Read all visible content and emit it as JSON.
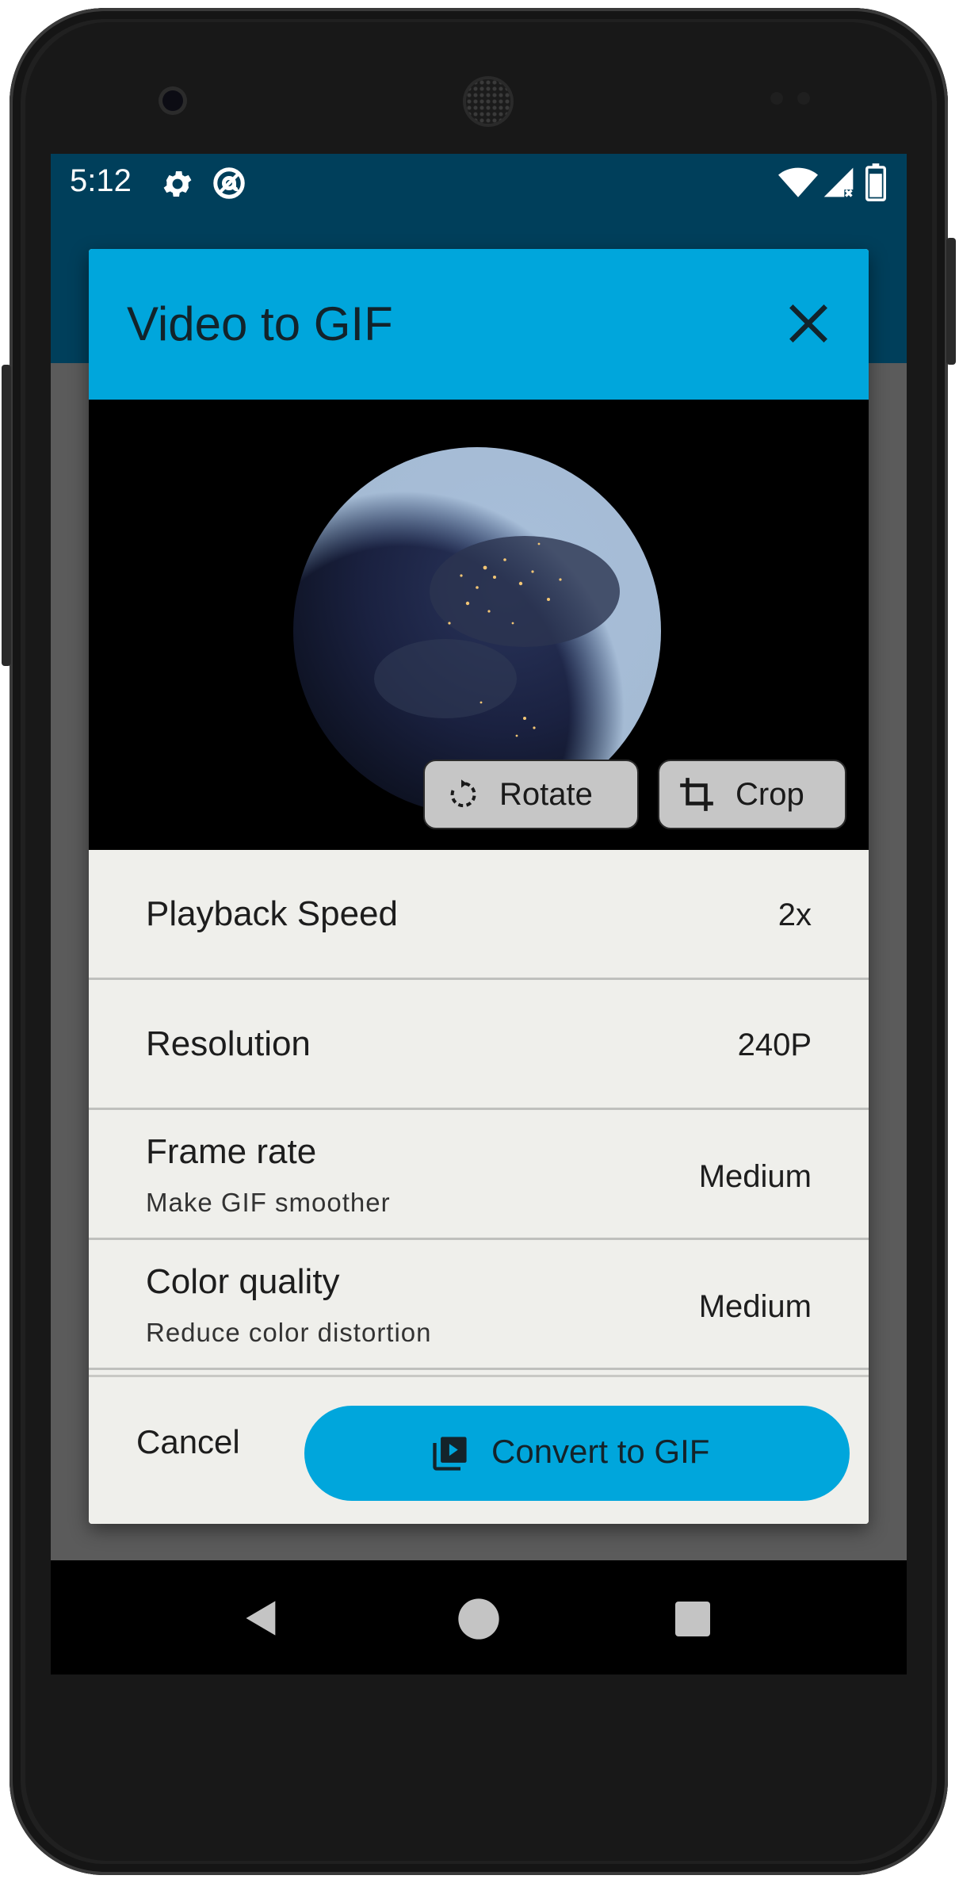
{
  "status_bar": {
    "time": "5:12",
    "icons": [
      "settings-icon",
      "at-sign-icon",
      "wifi-icon",
      "signal-icon",
      "battery-icon"
    ]
  },
  "dialog": {
    "title": "Video to GIF",
    "close_icon": "close-icon",
    "preview": {
      "rotate_label": "Rotate",
      "crop_label": "Crop"
    },
    "settings": [
      {
        "title": "Playback Speed",
        "value": "2x"
      },
      {
        "title": "Resolution",
        "value": "240P"
      },
      {
        "title": "Frame rate",
        "subtitle": "Make GIF smoother",
        "value": "Medium"
      },
      {
        "title": "Color quality",
        "subtitle": "Reduce color distortion",
        "value": "Medium"
      }
    ],
    "cancel_label": "Cancel",
    "convert_label": "Convert to GIF"
  },
  "colors": {
    "status_bar": "#003f5b",
    "accent": "#00a6dc",
    "dialog_bg": "#efefeb",
    "scrim": "#5b5b5b"
  }
}
